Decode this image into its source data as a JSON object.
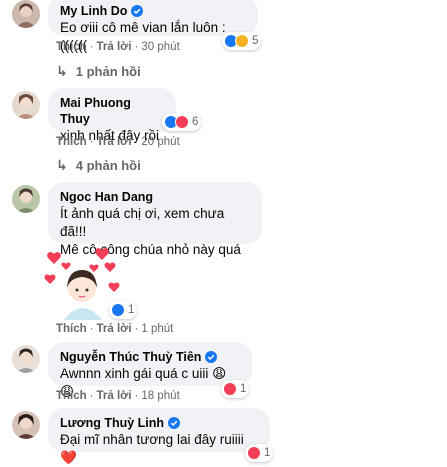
{
  "actions": {
    "like": "Thích",
    "reply": "Trả lời"
  },
  "comments": [
    {
      "author": "My Linh Do",
      "text": "Eo ơiii cô mê vian lắn luôn :((((((",
      "time": "30 phút",
      "reactions": [
        "like",
        "haha"
      ],
      "reaction_count": "5",
      "replies": "1 phản hồi"
    },
    {
      "author": "Mai Phuong Thuy",
      "text": "xinh nhất đây rồi",
      "time": "20 phút",
      "reactions": [
        "like",
        "love"
      ],
      "reaction_count": "6",
      "replies": "4 phản hồi"
    },
    {
      "author": "Ngoc Han Dang",
      "text_line1": "Ít ảnh quá chị ơi, xem chưa đã!!!",
      "text_line2": "Mê cô công chúa nhỏ này quá",
      "time": "1 phút",
      "reactions": [
        "like"
      ],
      "reaction_count": "1",
      "sticker": "girl-hearts-sticker"
    },
    {
      "author": "Nguyễn Thúc Thuỳ Tiên",
      "text": "Awnnn xinh gái quá c uiii 😩😩",
      "time": "18 phút",
      "reactions": [
        "love"
      ],
      "reaction_count": "1"
    },
    {
      "author": "Lương Thuỳ Linh",
      "text": "Đại mĩ nhân tương lai đây ruiiii ❤️",
      "reactions": [
        "love"
      ],
      "reaction_count": "1"
    }
  ],
  "colors": {
    "bubble": "#f0f2f5",
    "like": "#1877f2",
    "love": "#f33e58",
    "haha": "#f7b125",
    "meta": "#65676b"
  }
}
